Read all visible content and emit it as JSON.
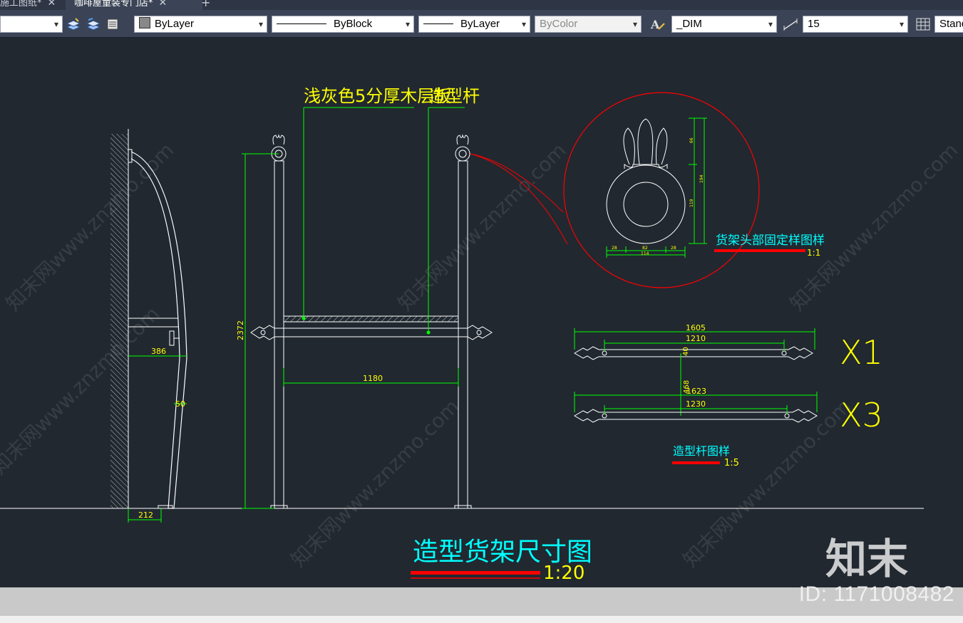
{
  "tabs": [
    {
      "label": "施工图纸*",
      "close": "✕"
    },
    {
      "label": "咖啡屋童装专门店*",
      "close": "✕"
    }
  ],
  "new_tab": "+",
  "toolbar": {
    "layer_select": "",
    "color": "ByLayer",
    "linetype": "ByBlock",
    "lineweight": "ByLayer",
    "plotstyle": "ByColor",
    "dim_style": "_DIM",
    "dim_value": "15",
    "table_style": "Standard"
  },
  "icons": [
    "layer-match-icon",
    "layer-previous-icon",
    "layer-state-icon",
    "text-style-icon",
    "dim-style-icon",
    "table-style-icon"
  ],
  "drawing": {
    "note_board": "浅灰色5分厚木层板",
    "note_rod": "造型杆",
    "dims": {
      "height": "2372",
      "width_inner": "1180",
      "side_depth": "386",
      "side_bottom": "212",
      "side_bend": "50",
      "rod1_total": "1605",
      "rod1_inner": "1210",
      "rod_small": "40",
      "rod_spacing": "468",
      "rod2_total": "1623",
      "rod2_inner": "1230",
      "detail_h1": "66",
      "detail_h2": "194",
      "detail_h3": "119",
      "detail_w1": "28",
      "detail_w2": "82",
      "detail_w3": "28",
      "detail_w_total": "114"
    },
    "detail_title": "货架头部固定样图样",
    "detail_scale": "1:1",
    "rod_title": "造型杆图样",
    "rod_scale": "1:5",
    "qty1": "X1",
    "qty2": "X3",
    "main_title": "造型货架尺寸图",
    "main_scale": "1:20"
  },
  "watermark": {
    "text": "知末网www.znzmo.com",
    "logo": "知末",
    "id": "ID: 1171008482"
  },
  "colors": {
    "canvas": "#212830",
    "dim_green": "#00ff00",
    "text_yellow": "#ffff00",
    "text_cyan": "#00ffff",
    "red": "#ff0000",
    "line_white": "#ffffff"
  }
}
